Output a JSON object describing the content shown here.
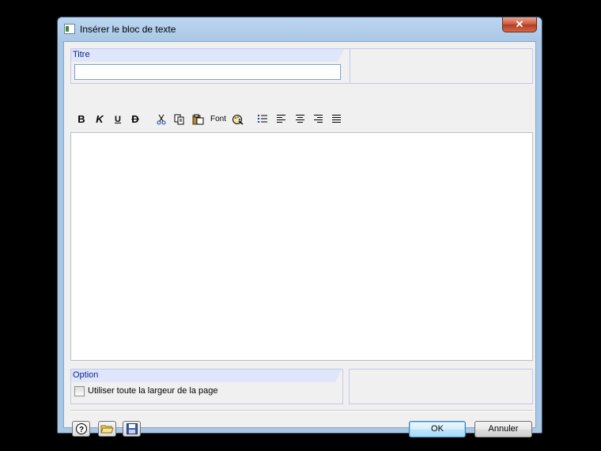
{
  "window": {
    "title": "Insérer le bloc de texte",
    "close_label": "✕"
  },
  "titre_group": {
    "label": "Titre",
    "value": ""
  },
  "toolbar": {
    "bold": "B",
    "italic": "K",
    "underline": "U",
    "strike": "D",
    "font": "Font",
    "icons": [
      "bold-icon",
      "italic-icon",
      "underline-icon",
      "strikethrough-icon",
      "cut-icon",
      "copy-icon",
      "paste-icon",
      "font-icon",
      "color-icon",
      "bullet-list-icon",
      "align-left-icon",
      "align-center-icon",
      "align-right-icon",
      "justify-icon"
    ]
  },
  "editor": {
    "content": ""
  },
  "option_group": {
    "label": "Option",
    "checkbox_label": "Utiliser toute la largeur de la page",
    "checked": false
  },
  "buttons": {
    "ok": "OK",
    "cancel": "Annuler"
  }
}
